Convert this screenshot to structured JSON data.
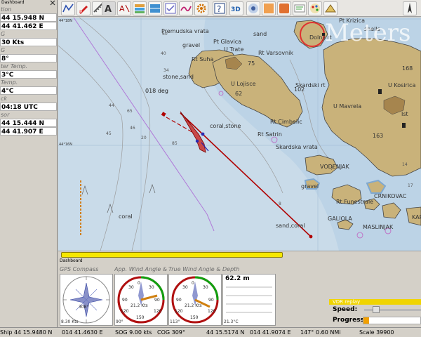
{
  "left_panel": {
    "title": "Dashboard",
    "items": [
      {
        "label": "Position",
        "value": "44 15.948 N",
        "label_vis": "tion"
      },
      {
        "label": "",
        "value": "44 41.462 E"
      },
      {
        "label": "SOG",
        "value": "30 Kts",
        "label_vis": "G"
      },
      {
        "label": "COG",
        "value": "8°",
        "label_vis": "G"
      },
      {
        "label": "Water Temp.",
        "value": "3°C",
        "label_vis": "ter Temp."
      },
      {
        "label": "Air Temp.",
        "value": "4°C",
        "label_vis": "Temp."
      },
      {
        "label": "Clock",
        "value": "04:18 UTC",
        "label_vis": "ck"
      },
      {
        "label": "Cursor",
        "value": "44 15.444 N",
        "label_vis": "sor"
      },
      {
        "label": "",
        "value": "44 41.907 E"
      }
    ]
  },
  "chart": {
    "lat_labels": [
      "44°16N",
      "44°18N"
    ],
    "place_labels": [
      "Premudska vrata",
      "sand",
      "gravel",
      "Pt Glavica",
      "U Trate",
      "Rt Suha",
      "Rt Varsovnik",
      "stone,sand",
      "U Lojisce",
      "Skardski rt",
      "U Kosirica",
      "U Mavrela",
      "Ist",
      "018 deg",
      "Rt Cimbelic",
      "coral,stone",
      "Rt Satrin",
      "Skardska vrata",
      "VODENJAK",
      "gravel",
      "Rt Funestrale",
      "CRNIKOVAC",
      "GALIOLA",
      "MASLINJAK",
      "coral",
      "sand,coral",
      "Pt Krizica",
      "shells",
      "Dolnji rt",
      "KAR"
    ],
    "watermark": "Meters",
    "depths": [
      "75",
      "62",
      "102",
      "168",
      "163",
      "34",
      "40",
      "44",
      "65",
      "45",
      "46",
      "85",
      "8",
      "7",
      "17",
      "14",
      "60",
      "20"
    ]
  },
  "dashboard": {
    "title": "Dashboard",
    "instruments": [
      {
        "title": "GPS Compass",
        "heading": "308°",
        "sog": "8.30 Kts"
      },
      {
        "title": "App. Wind Angle & Speed",
        "speed": "21.2 Kts",
        "angle": "90°"
      },
      {
        "title": "True Wind Angle & Speed",
        "speed": "21.2 Kts",
        "angle": "113°"
      },
      {
        "title": "Depth",
        "depth": "62.2 m",
        "temp": "21.3°C"
      }
    ]
  },
  "replay": {
    "title": "VDR replay",
    "speed_label": "Speed:",
    "progress_label": "Progress:",
    "progress": 0.1
  },
  "status": {
    "ship": "Ship 44 15.9480 N",
    "ship_e": "014 41.4630 E",
    "sog": "SOG 9.00 kts",
    "cog": "COG 309°",
    "cursor_n": "44 15.5174 N",
    "cursor_e": "014 41.9074 E",
    "brg": "147°",
    "dist": "0.60 NMi",
    "scale": "Scale 39900"
  }
}
